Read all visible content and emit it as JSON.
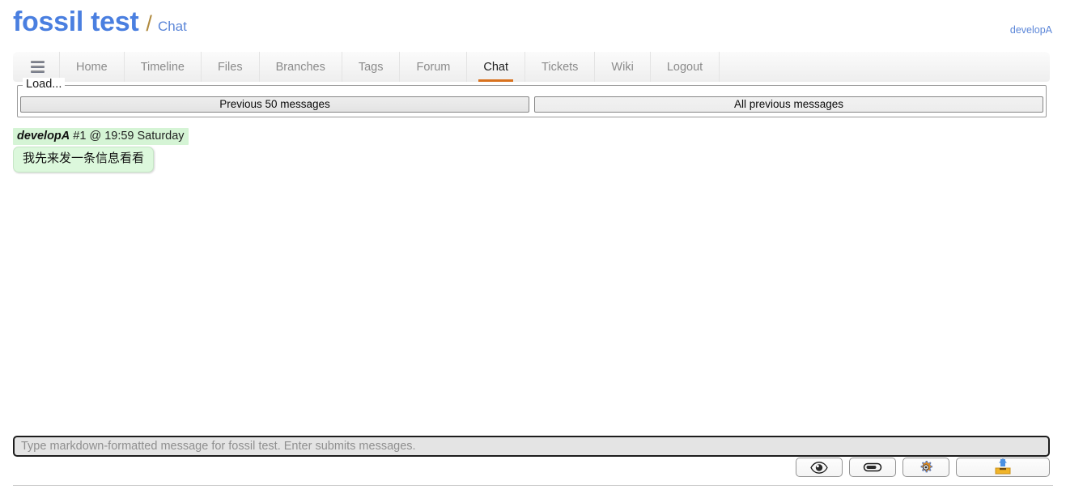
{
  "header": {
    "title": "fossil test",
    "separator": "/",
    "subtitle": "Chat",
    "user": "developA"
  },
  "nav": {
    "menu_icon": "hamburger-icon",
    "items": [
      {
        "label": "Home",
        "active": false
      },
      {
        "label": "Timeline",
        "active": false
      },
      {
        "label": "Files",
        "active": false
      },
      {
        "label": "Branches",
        "active": false
      },
      {
        "label": "Tags",
        "active": false
      },
      {
        "label": "Forum",
        "active": false
      },
      {
        "label": "Chat",
        "active": true
      },
      {
        "label": "Tickets",
        "active": false
      },
      {
        "label": "Wiki",
        "active": false
      },
      {
        "label": "Logout",
        "active": false
      }
    ],
    "active_underline_color": "#d9721e"
  },
  "load_panel": {
    "legend": "Load...",
    "previous_50_label": "Previous 50 messages",
    "all_previous_label": "All previous messages"
  },
  "messages": [
    {
      "user": "developA",
      "info": "#1 @ 19:59 Saturday",
      "text": "我先来发一条信息看看",
      "meta_bg": "#d5f4d5",
      "bubble_bg": "#dcf8dc"
    }
  ],
  "composer": {
    "placeholder": "Type markdown-formatted message for fossil test. Enter submits messages.",
    "value": ""
  },
  "toolbar": {
    "buttons": [
      {
        "icon": "eye-icon",
        "name": "preview-button"
      },
      {
        "icon": "paperclip-icon",
        "name": "attach-button"
      },
      {
        "icon": "gear-icon",
        "name": "settings-button"
      },
      {
        "icon": "upload-icon",
        "name": "upload-button"
      }
    ]
  },
  "colors": {
    "brand": "#4a7fe0",
    "accent": "#d9721e",
    "link": "#5b86d8"
  }
}
